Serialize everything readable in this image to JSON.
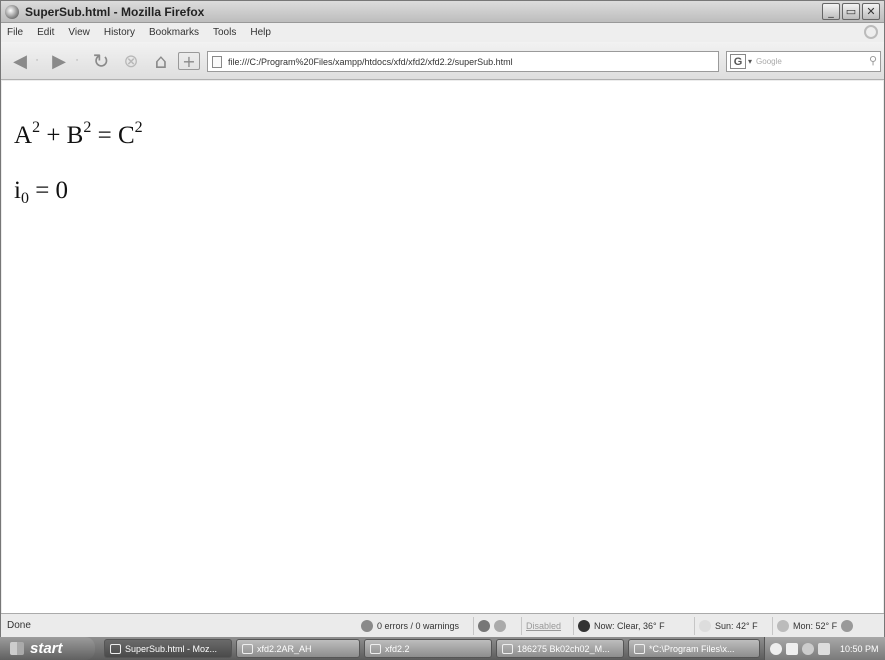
{
  "window": {
    "title": "SuperSub.html - Mozilla Firefox",
    "controls": [
      "_",
      "▭",
      "✕"
    ]
  },
  "menu": [
    "File",
    "Edit",
    "View",
    "History",
    "Bookmarks",
    "Tools",
    "Help"
  ],
  "nav": {
    "back": "◀",
    "forward": "▶",
    "reload": "↻",
    "stop": "⊗",
    "home": "⌂",
    "new_tab": "+",
    "url": "file:///C:/Program%20Files/xampp/htdocs/xfd/xfd2/xfd2.2/superSub.html",
    "url_dropdown": "▾",
    "go": "▶",
    "search_engine": "G",
    "search_engine_dropdown": "▾",
    "search_placeholder": "Google",
    "search_go": "⚲"
  },
  "content": {
    "eq1": {
      "a": "A",
      "a_exp": "2",
      "plus": " + ",
      "b": "B",
      "b_exp": "2",
      "equals": " = ",
      "c": "C",
      "c_exp": "2"
    },
    "eq2": {
      "i": "i",
      "i_sub": "0",
      "rest": " = 0"
    }
  },
  "status": {
    "left": "Done",
    "errors": "0 errors / 0 warnings",
    "disabled": "Disabled",
    "weather_now": "Now: Clear, 36° F",
    "weather_sun": "Sun: 42° F",
    "weather_mon": "Mon: 52° F"
  },
  "taskbar": {
    "start": "start",
    "tasks": [
      "SuperSub.html - Moz...",
      "xfd2.2AR_AH",
      "xfd2.2",
      "186275 Bk02ch02_M...",
      "*C:\\Program Files\\x..."
    ],
    "clock": "10:50 PM"
  },
  "icons": {
    "app": "firefox-icon",
    "throbber": "activity-throbber-icon"
  }
}
